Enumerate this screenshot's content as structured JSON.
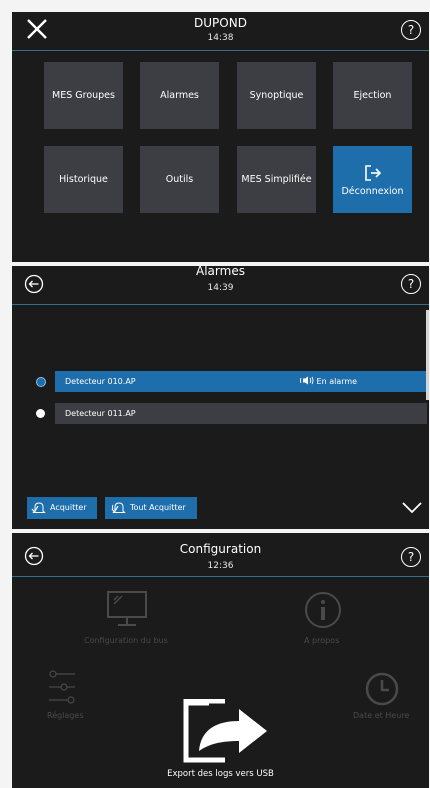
{
  "panel1": {
    "title": "DUPOND",
    "time": "14:38",
    "help": "?",
    "tiles": [
      {
        "label": "MES Groupes"
      },
      {
        "label": "Alarmes"
      },
      {
        "label": "Synoptique"
      },
      {
        "label": "Ejection"
      },
      {
        "label": "Historique"
      },
      {
        "label": "Outils"
      },
      {
        "label": "MES Simplifiée"
      },
      {
        "label": "Déconnexion"
      }
    ]
  },
  "panel2": {
    "title": "Alarmes",
    "time": "14:39",
    "help": "?",
    "rows": [
      {
        "name": "Detecteur 010.AP",
        "state": "En alarme"
      },
      {
        "name": "Detecteur 011.AP",
        "state": ""
      }
    ],
    "acquit_label": "Acquitter",
    "acquit_all_label": "Tout Acquitter"
  },
  "panel3": {
    "title": "Configuration",
    "time": "12:36",
    "help": "?",
    "bus_label": "Configuration du bus",
    "about_label": "A propos",
    "settings_label": "Réglages",
    "datetime_label": "Date et Heure",
    "export_label": "Export des logs vers USB"
  },
  "colors": {
    "panel_bg": "#1b1b1b",
    "tile_bg": "#3d3e43",
    "accent": "#1f6eac",
    "divider": "#2f6f8f",
    "disabled": "#4a4a4a"
  }
}
